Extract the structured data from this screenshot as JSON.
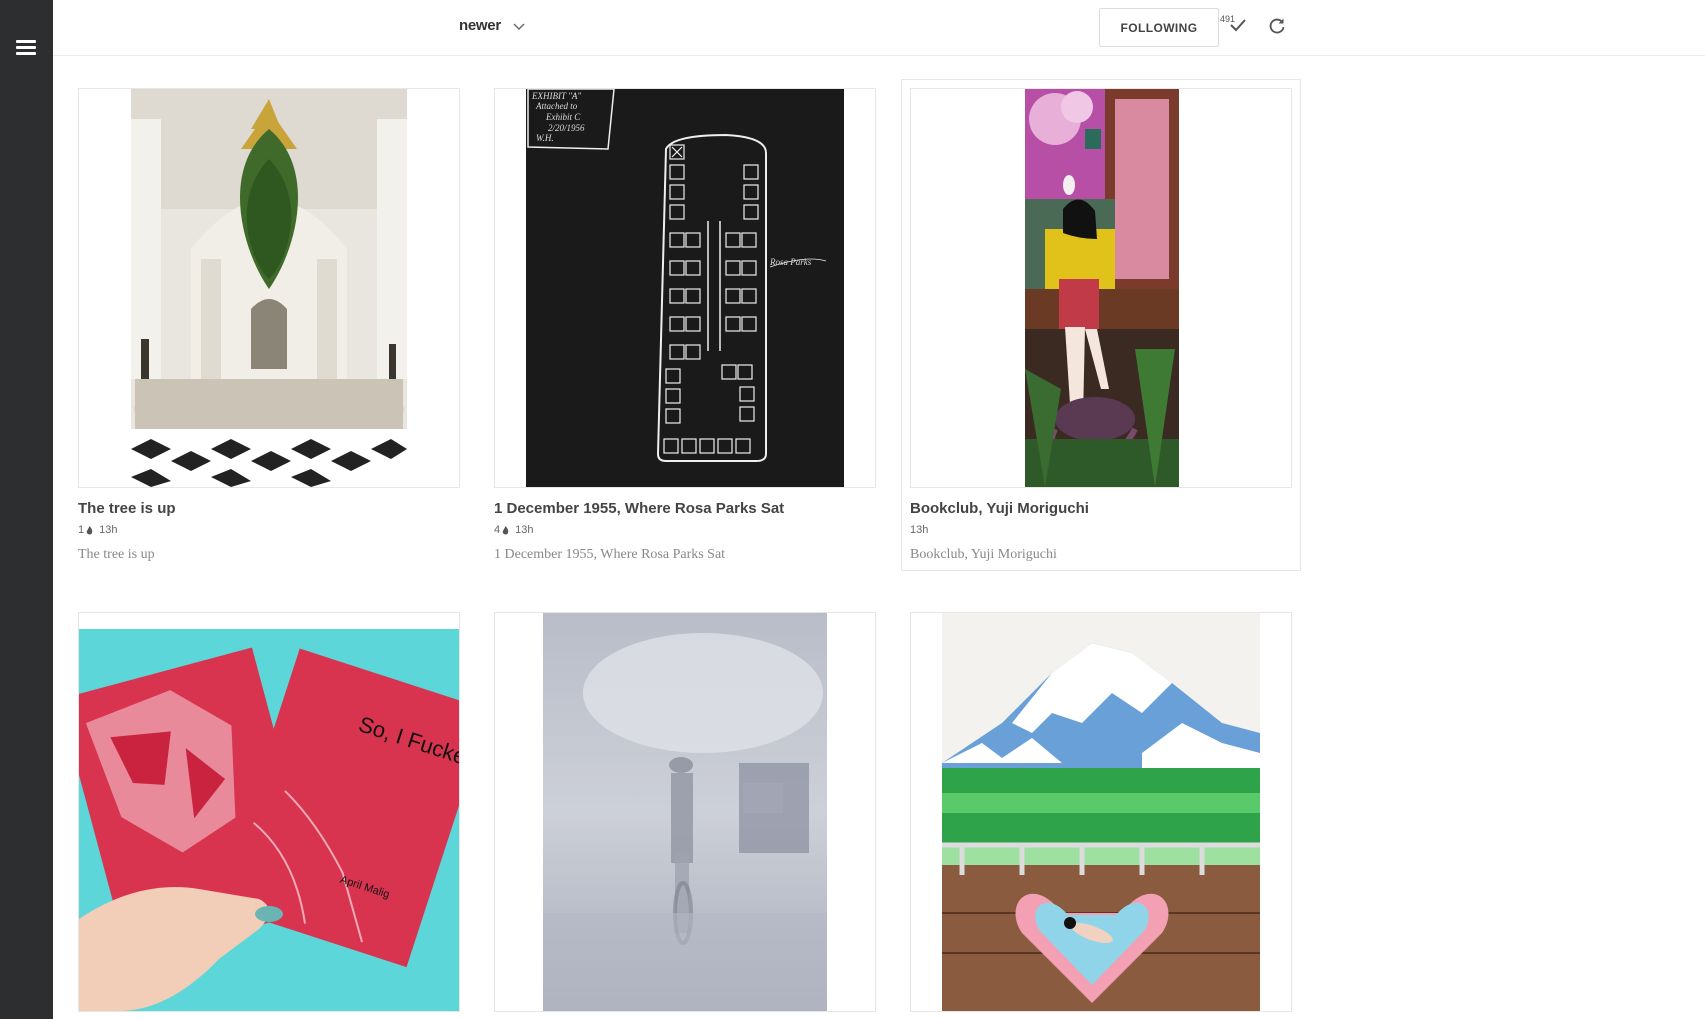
{
  "sort": {
    "label": "newer"
  },
  "header": {
    "following_label": "FOLLOWING",
    "count": "491"
  },
  "cards": [
    {
      "title": "The tree is up",
      "count": "1",
      "time": "13h",
      "description": "The tree is up"
    },
    {
      "title": "1 December 1955, Where Rosa Parks Sat",
      "count": "4",
      "time": "13h",
      "description": "1 December 1955, Where Rosa Parks Sat"
    },
    {
      "title": "Bookclub, Yuji Moriguchi",
      "time": "13h",
      "description": "Bookclub, Yuji Moriguchi"
    },
    {
      "cover_title": "So, I Fucked Up",
      "cover_author": "April Malig"
    },
    {},
    {}
  ],
  "colors": {
    "sidebar": "#2c2e30",
    "accent": "#333333"
  },
  "icons": [
    "menu-icon",
    "chevron-down-icon",
    "checkmark-icon",
    "refresh-icon",
    "flame-icon"
  ]
}
